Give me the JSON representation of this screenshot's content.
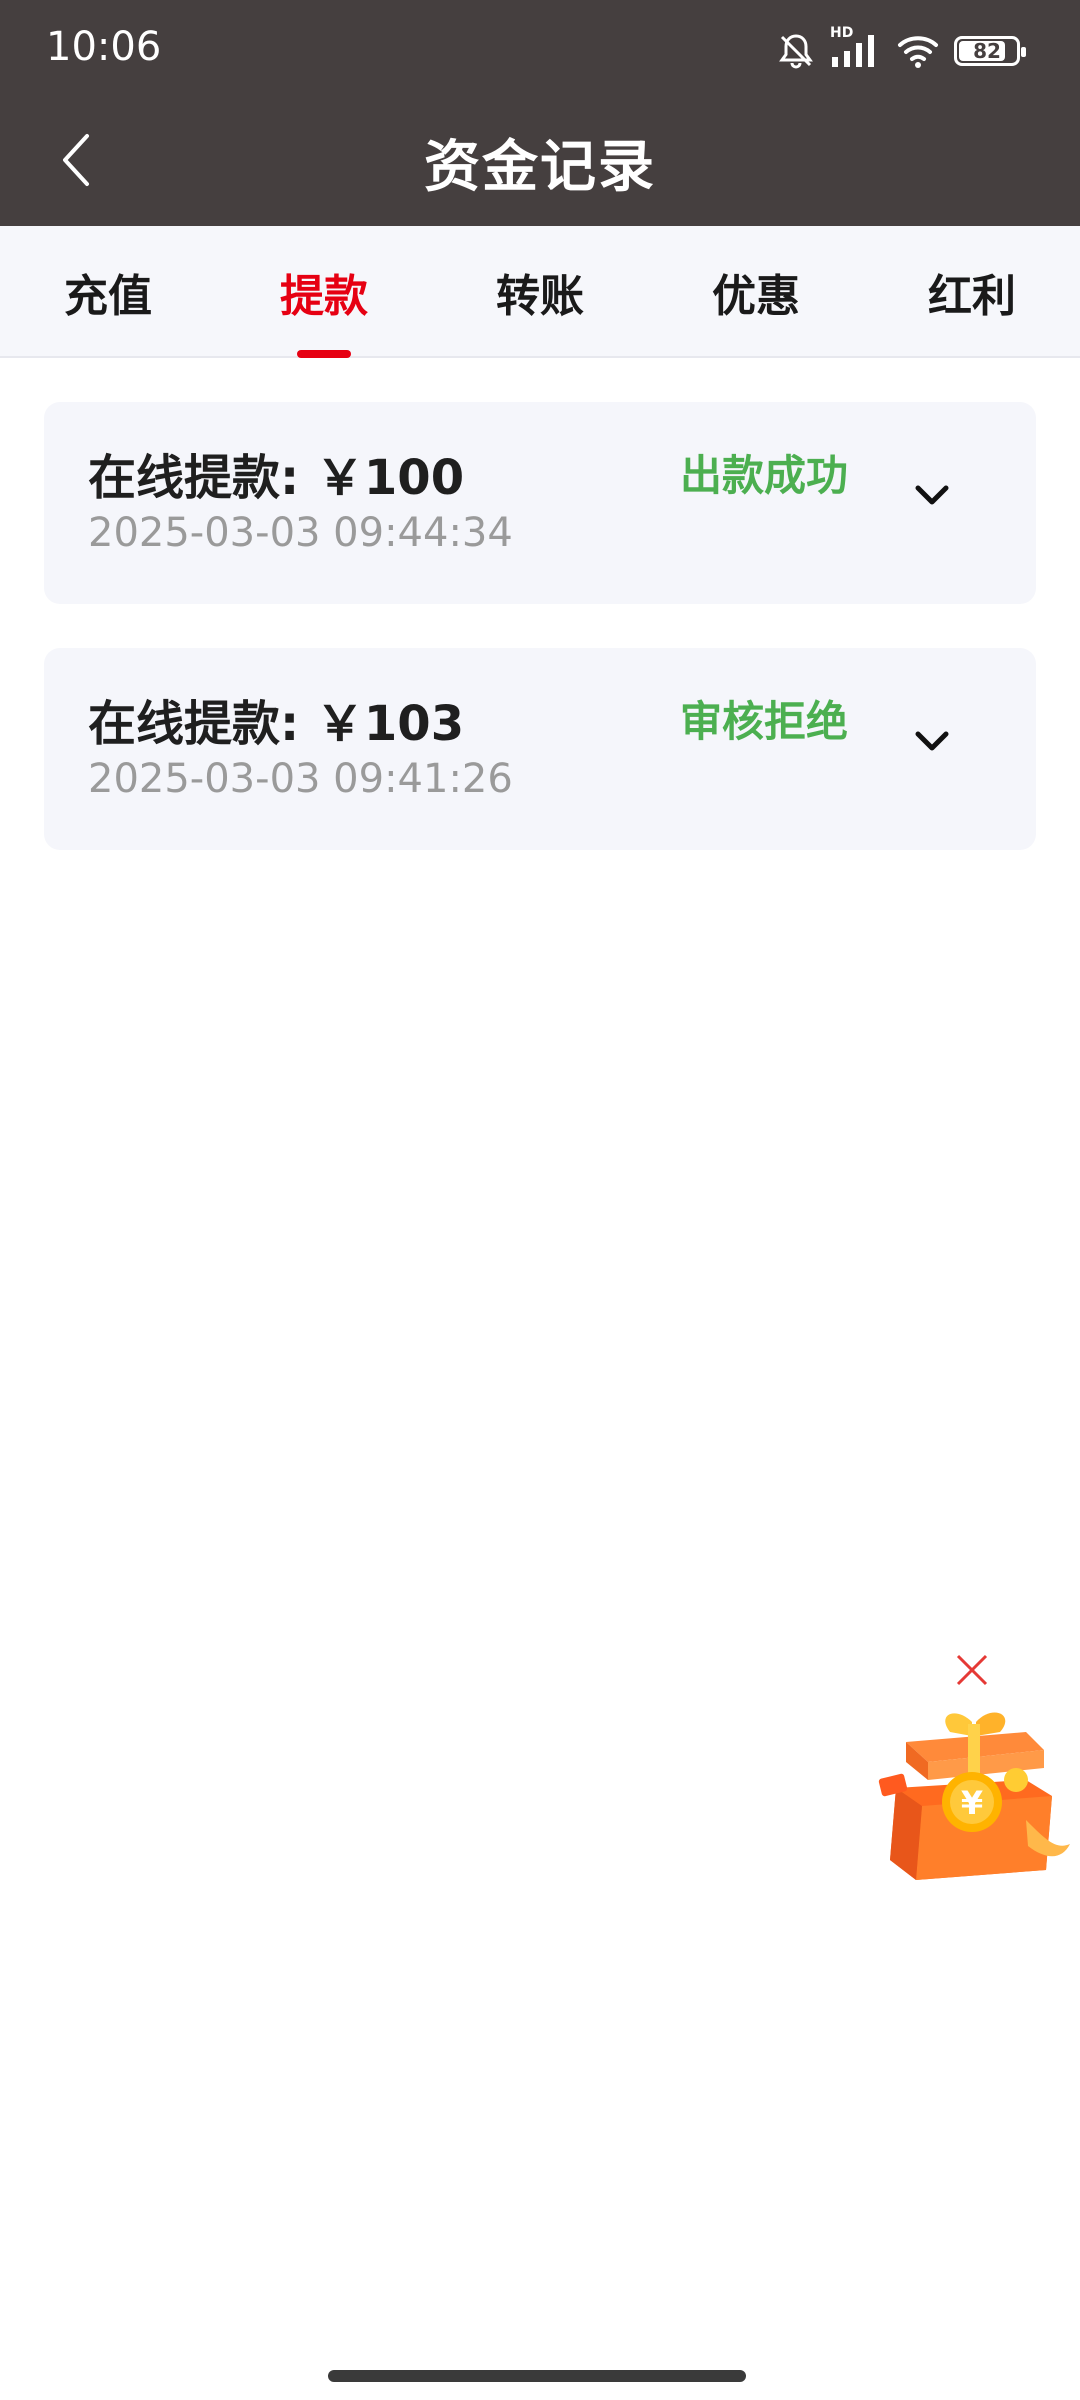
{
  "status_bar": {
    "time": "10:06",
    "network_label": "HD",
    "battery_level": "82",
    "battery_fraction": 0.82
  },
  "nav": {
    "title": "资金记录",
    "back_icon": "chevron-left-icon"
  },
  "tabs": [
    {
      "label": "充值",
      "active": false
    },
    {
      "label": "提款",
      "active": true
    },
    {
      "label": "转账",
      "active": false
    },
    {
      "label": "优惠",
      "active": false
    },
    {
      "label": "红利",
      "active": false
    }
  ],
  "records": [
    {
      "title": "在线提款: ￥100",
      "time": "2025-03-03 09:44:34",
      "status": "出款成功"
    },
    {
      "title": "在线提款: ￥103",
      "time": "2025-03-03 09:41:26",
      "status": "审核拒绝"
    }
  ],
  "colors": {
    "header_bg": "#453f3f",
    "accent": "#e60012",
    "status_green": "#4caf50",
    "card_bg": "#f5f6fb"
  },
  "floating_gift": {
    "icon": "gift-box-icon",
    "close_icon": "close-icon"
  }
}
